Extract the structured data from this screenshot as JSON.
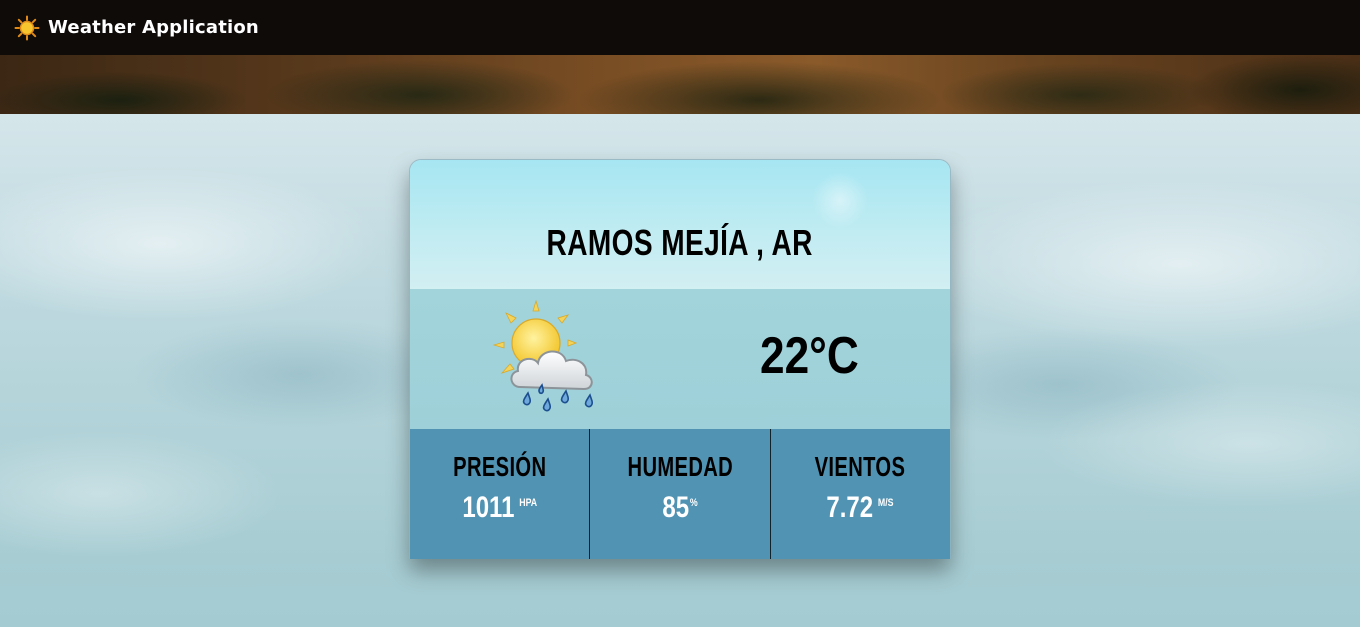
{
  "navbar": {
    "title": "Weather Application",
    "icon": "sun-icon"
  },
  "weather": {
    "city": "RAMOS MEJÍA , AR",
    "temperature": "22°C",
    "condition_icon": "sun-cloud-rain-icon"
  },
  "stats": [
    {
      "label": "PRESIÓN",
      "value": "1011",
      "unit": "HPA"
    },
    {
      "label": "HUMEDAD",
      "value": "85",
      "unit": "%"
    },
    {
      "label": "VIENTOS",
      "value": "7.72",
      "unit": "M/S"
    }
  ],
  "colors": {
    "navbar_bg": "#0e0b09",
    "stats_bg": "#5193b3",
    "header_bg": "#c2ecf2"
  }
}
